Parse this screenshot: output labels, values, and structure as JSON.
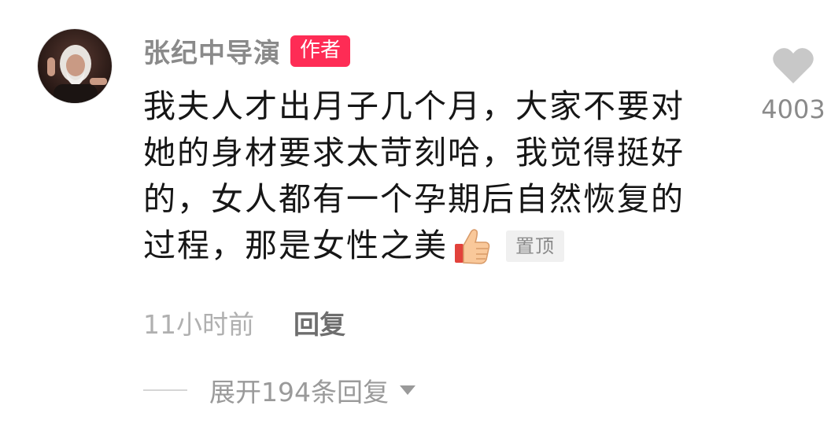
{
  "author": {
    "name": "张纪中导演",
    "badge": "作者"
  },
  "comment": {
    "lines": [
      "我夫人才出月子几个月，大家不要对",
      "她的身材要求太苛刻哈，我觉得挺好",
      "的，女人都有一个孕期后自然恢复的",
      "过程，那是女性之美"
    ],
    "emoji": "thumbs-up-icon",
    "pinned_tag": "置顶"
  },
  "likes": {
    "count": "4003",
    "icon": "heart-icon",
    "color": "#c8c8c8"
  },
  "meta": {
    "timestamp": "11小时前",
    "reply_label": "回复"
  },
  "replies": {
    "expand_label": "展开194条回复",
    "icon": "caret-down-icon"
  },
  "colors": {
    "badge": "#fe2c55",
    "text": "#161616",
    "muted": "#8a8a8a"
  }
}
